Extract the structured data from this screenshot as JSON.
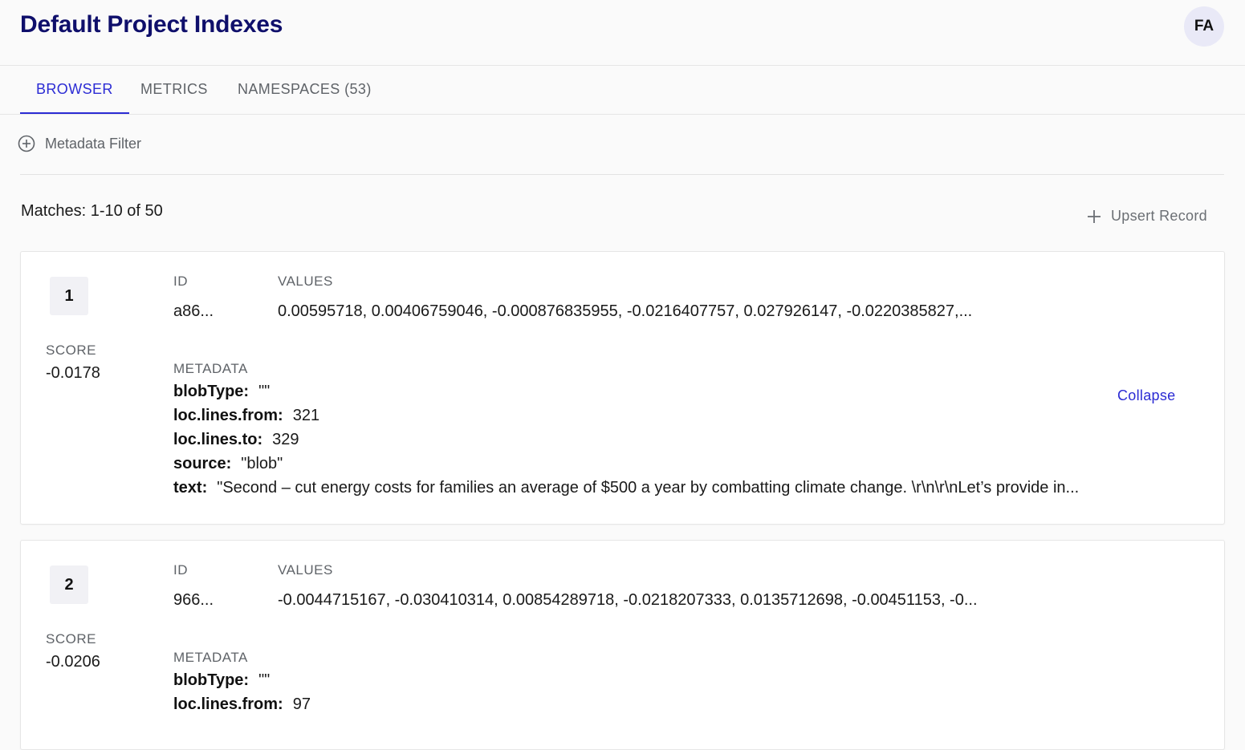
{
  "header": {
    "title": "Default Project Indexes",
    "avatar_initials": "FA"
  },
  "tabs": [
    {
      "label": "BROWSER",
      "active": true
    },
    {
      "label": "METRICS",
      "active": false
    },
    {
      "label": "NAMESPACES (53)",
      "active": false
    }
  ],
  "filter": {
    "label": "Metadata Filter",
    "icon": "plus-circle-icon"
  },
  "results": {
    "matches_text": "Matches: 1-10 of 50",
    "upsert_label": "Upsert Record",
    "upsert_icon": "plus-icon",
    "col_id": "ID",
    "col_values": "VALUES",
    "col_metadata": "METADATA",
    "col_score": "SCORE",
    "collapse_label": "Collapse",
    "records": [
      {
        "rank": "1",
        "score": "-0.0178",
        "id": "a86...",
        "values": "0.00595718, 0.00406759046, -0.000876835955, -0.0216407757, 0.027926147, -0.0220385827,...",
        "metadata": [
          {
            "key": "blobType:",
            "value": "\"\""
          },
          {
            "key": "loc.lines.from:",
            "value": "321"
          },
          {
            "key": "loc.lines.to:",
            "value": "329"
          },
          {
            "key": "source:",
            "value": "\"blob\""
          },
          {
            "key": "text:",
            "value": "\"Second – cut energy costs for families an average of $500 a year by combatting climate change. \\r\\n\\r\\nLet’s provide in..."
          }
        ]
      },
      {
        "rank": "2",
        "score": "-0.0206",
        "id": "966...",
        "values": "-0.0044715167, -0.030410314, 0.00854289718, -0.0218207333, 0.0135712698, -0.00451153, -0...",
        "metadata": [
          {
            "key": "blobType:",
            "value": "\"\""
          },
          {
            "key": "loc.lines.from:",
            "value": "97"
          }
        ]
      }
    ]
  },
  "colors": {
    "title": "#0f0f6b",
    "accent": "#2b2bd4",
    "muted": "#5f6368"
  }
}
